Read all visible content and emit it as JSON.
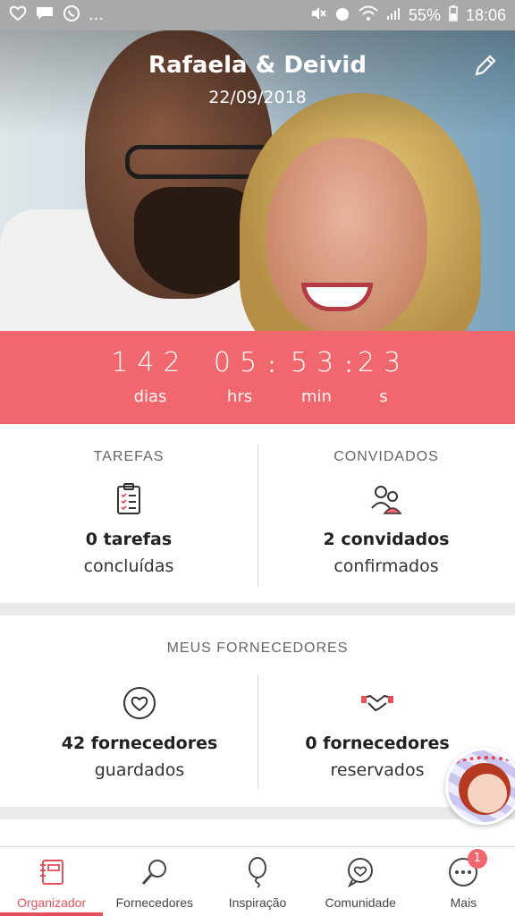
{
  "status_bar": {
    "battery_percent": "55%",
    "time": "18:06",
    "left_icons": [
      "heart-outline-icon",
      "chat-bubble-icon",
      "whatsapp-icon",
      "more-dots-icon"
    ],
    "right_icons": [
      "mute-icon",
      "alarm-icon",
      "wifi-icon",
      "signal-icon",
      "battery-icon"
    ]
  },
  "hero": {
    "couple_names": "Rafaela & Deivid",
    "wedding_date": "22/09/2018",
    "edit_icon": "pencil-icon"
  },
  "countdown": {
    "days": "142",
    "hours": "05",
    "minutes": "53",
    "seconds": "23",
    "days_label": "dias",
    "hours_label": "hrs",
    "minutes_label": "min",
    "seconds_label": "s"
  },
  "stats": {
    "tasks": {
      "title": "TAREFAS",
      "count": "0 tarefas",
      "sub": "concluídas",
      "icon": "clipboard-checklist-icon"
    },
    "guests": {
      "title": "CONVIDADOS",
      "count": "2 convidados",
      "sub": "confirmados",
      "icon": "couple-people-icon"
    }
  },
  "vendors": {
    "title": "MEUS FORNECEDORES",
    "saved": {
      "count": "42 fornecedores",
      "sub": "guardados",
      "icon": "heart-circle-icon"
    },
    "booked": {
      "count": "0 fornecedores",
      "sub": "reservados",
      "icon": "handshake-icon"
    }
  },
  "bottom_nav": {
    "items": [
      {
        "label": "Organizador",
        "icon": "notebook-icon",
        "active": true
      },
      {
        "label": "Fornecedores",
        "icon": "search-icon"
      },
      {
        "label": "Inspiração",
        "icon": "balloon-icon"
      },
      {
        "label": "Comunidade",
        "icon": "chat-heart-icon"
      },
      {
        "label": "Mais",
        "icon": "more-circle-icon",
        "badge": "1"
      }
    ]
  },
  "colors": {
    "accent": "#f0676d",
    "active_nav": "#e5515b",
    "status_bar": "#a9a9a9"
  }
}
